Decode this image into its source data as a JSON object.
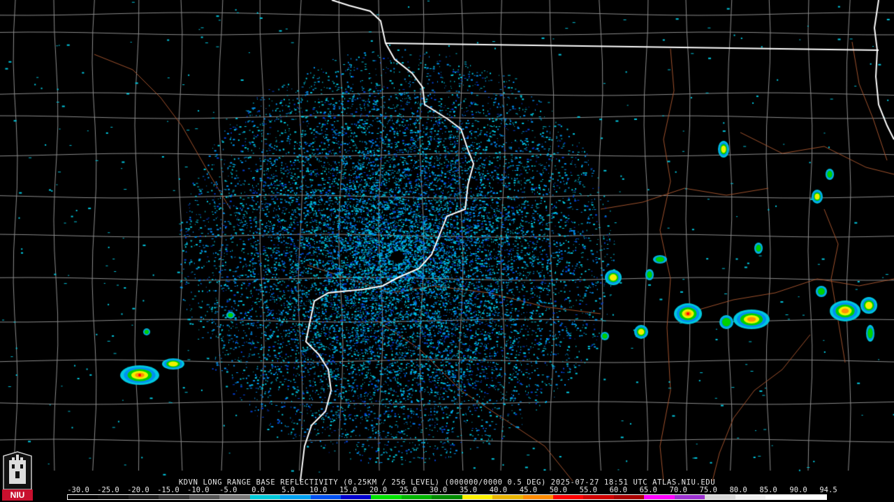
{
  "caption": {
    "product": "KDVN LONG RANGE BASE REFLECTIVITY (0.25KM / 256 LEVEL) (000000/0000 0.5 DEG) 2025-07-27 18:51 UTC  ATLAS.NIU.EDU"
  },
  "logo": {
    "label": "NIU"
  },
  "scale": {
    "labels": [
      "-30.0",
      "-25.0",
      "-20.0",
      "-15.0",
      "-10.0",
      "-5.0",
      "0.0",
      "5.0",
      "10.0",
      "15.0",
      "20.0",
      "25.0",
      "30.0",
      "35.0",
      "40.0",
      "45.0",
      "50.0",
      "55.0",
      "60.0",
      "65.0",
      "70.0",
      "75.0",
      "80.0",
      "85.0",
      "90.0",
      "94.5"
    ],
    "colors": [
      "#000000",
      "#0a0a0a",
      "#1a1a1a",
      "#333333",
      "#555555",
      "#777777",
      "#00c8d8",
      "#00a0f0",
      "#0050f0",
      "#0000d0",
      "#00e000",
      "#00b400",
      "#008a00",
      "#fff000",
      "#e8b400",
      "#ff8a00",
      "#ff0000",
      "#d00000",
      "#a80000",
      "#ff00ff",
      "#9b30d0",
      "#d8d8d8",
      "#f0f0f0",
      "#ffffff",
      "#ffffff"
    ]
  },
  "map": {
    "state_line_color": "#ffffff",
    "county_line_color": "#8c8c8c",
    "river_road_color": "#a0522d",
    "echo_colors": {
      "light": "#00c8e0",
      "mid": "#0090f0",
      "deep": "#0040d8",
      "green": "#00d000",
      "yellow": "#f0f000",
      "orange": "#ff9000",
      "red": "#ff0000"
    }
  }
}
